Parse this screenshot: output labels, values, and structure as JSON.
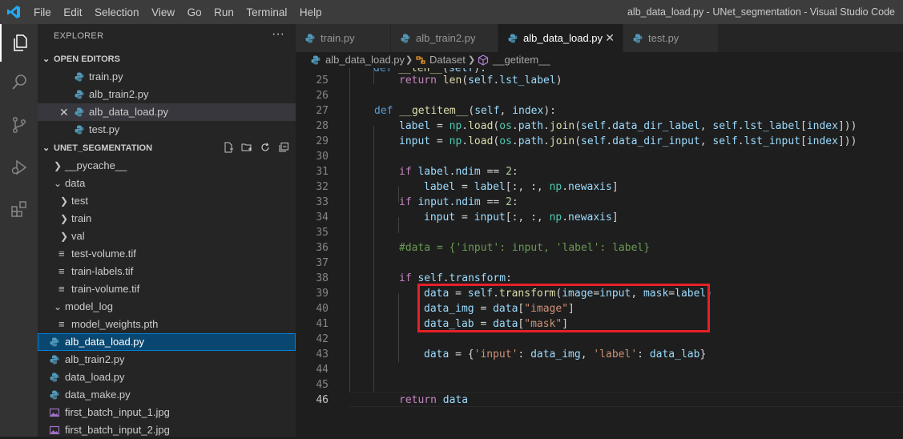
{
  "window": {
    "title": "alb_data_load.py - UNet_segmentation - Visual Studio Code",
    "menu": [
      "File",
      "Edit",
      "Selection",
      "View",
      "Go",
      "Run",
      "Terminal",
      "Help"
    ]
  },
  "activity_bar": [
    "explorer-icon",
    "search-icon",
    "source-control-icon",
    "run-debug-icon",
    "extensions-icon"
  ],
  "sidebar": {
    "header": "EXPLORER",
    "open_editors": {
      "title": "OPEN EDITORS",
      "items": [
        "train.py",
        "alb_train2.py",
        "alb_data_load.py",
        "test.py"
      ]
    },
    "project": {
      "title": "UNET_SEGMENTATION",
      "tree": [
        {
          "label": "__pycache__",
          "type": "folder",
          "depth": 1,
          "open": false
        },
        {
          "label": "data",
          "type": "folder",
          "depth": 1,
          "open": true
        },
        {
          "label": "test",
          "type": "folder",
          "depth": 2,
          "open": false
        },
        {
          "label": "train",
          "type": "folder",
          "depth": 2,
          "open": false
        },
        {
          "label": "val",
          "type": "folder",
          "depth": 2,
          "open": false
        },
        {
          "label": "test-volume.tif",
          "type": "file",
          "depth": 2
        },
        {
          "label": "train-labels.tif",
          "type": "file",
          "depth": 2
        },
        {
          "label": "train-volume.tif",
          "type": "file",
          "depth": 2
        },
        {
          "label": "model_log",
          "type": "folder",
          "depth": 1,
          "open": true
        },
        {
          "label": "model_weights.pth",
          "type": "file",
          "depth": 2
        },
        {
          "label": "alb_data_load.py",
          "type": "py",
          "depth": 1
        },
        {
          "label": "alb_train2.py",
          "type": "py",
          "depth": 1
        },
        {
          "label": "data_load.py",
          "type": "py",
          "depth": 1
        },
        {
          "label": "data_make.py",
          "type": "py",
          "depth": 1
        },
        {
          "label": "first_batch_input_1.jpg",
          "type": "img",
          "depth": 1
        },
        {
          "label": "first_batch_input_2.jpg",
          "type": "img",
          "depth": 1
        }
      ]
    }
  },
  "tabs": [
    "train.py",
    "alb_train2.py",
    "alb_data_load.py",
    "test.py"
  ],
  "breadcrumb": {
    "file": "alb_data_load.py",
    "class": "Dataset",
    "method": "__getitem__"
  },
  "editor": {
    "line_numbers": [
      "25",
      "26",
      "27",
      "28",
      "29",
      "30",
      "31",
      "32",
      "33",
      "34",
      "35",
      "36",
      "37",
      "38",
      "39",
      "40",
      "41",
      "42",
      "43",
      "44",
      "45",
      "46"
    ],
    "lines": {
      "l24": "def __len__(self):",
      "l25": "return len(self.lst_label)",
      "l27": "def __getitem__(self, index):",
      "l28": "label = np.load(os.path.join(self.data_dir_label, self.lst_label[index]))",
      "l29": "input = np.load(os.path.join(self.data_dir_input, self.lst_input[index]))",
      "l31": "if label.ndim == 2:",
      "l32": "label = label[:, :, np.newaxis]",
      "l33": "if input.ndim == 2:",
      "l34": "input = input[:, :, np.newaxis]",
      "l36": "#data = {'input': input, 'label': label}",
      "l38": "if self.transform:",
      "l39": "data = self.transform(image=input, mask=label)",
      "l40": "data_img = data[\"image\"]",
      "l41": "data_lab = data[\"mask\"]",
      "l43": "data = {'input': data_img, 'label': data_lab}",
      "l46": "return data"
    }
  },
  "colors": {
    "accent_highlight": "#e8202a",
    "python_icon": "#519aba",
    "selection": "#094771"
  }
}
